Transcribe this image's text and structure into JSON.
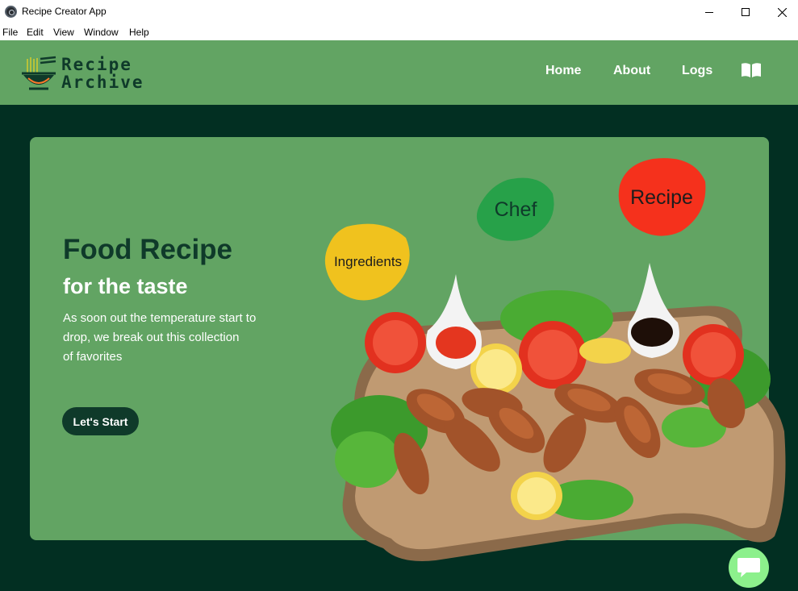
{
  "window": {
    "title": "Recipe Creator App",
    "menu": [
      "File",
      "Edit",
      "View",
      "Window",
      "Help"
    ]
  },
  "nav": {
    "logo_line1": "Recipe",
    "logo_line2": "Archive",
    "links": [
      "Home",
      "About",
      "Logs"
    ],
    "book_icon": "open-book-icon"
  },
  "hero": {
    "title": "Food Recipe",
    "subtitle": "for the taste",
    "description_lines": [
      "As soon out the temperature start to",
      "drop, we break out this collection",
      "of favorites"
    ],
    "cta_label": "Let's Start",
    "blobs": {
      "ingredients": "Ingredients",
      "chef": "Chef",
      "recipe": "Recipe"
    }
  },
  "colors": {
    "nav_green": "#62a463",
    "dark_green": "#022f22",
    "text_dark": "#0f3a2a",
    "blob_yellow": "#f0c21e",
    "blob_green": "#27a149",
    "blob_red": "#f5311c",
    "chat_green": "#8cf08c"
  },
  "chat_icon": "chat-bubble-icon"
}
